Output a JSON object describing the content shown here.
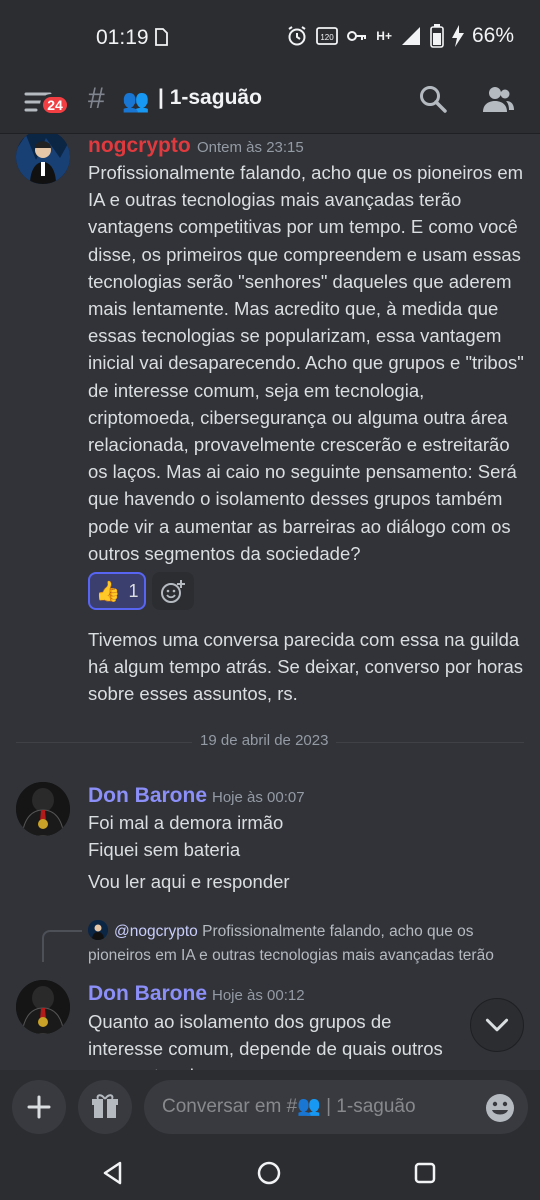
{
  "status_bar": {
    "time": "01:19",
    "battery": "66%",
    "network": "H+"
  },
  "channel_header": {
    "unread_badge": "24",
    "hash": "#",
    "channel_emoji": "👥",
    "channel_name": "| 1-saguão"
  },
  "messages": [
    {
      "author": "nogcrypto",
      "author_color": "#e03a3e",
      "timestamp": "Ontem às 23:15",
      "text": "Profissionalmente falando, acho que os pioneiros em IA e outras tecnologias mais avançadas terão vantagens competitivas por um tempo. E como você disse, os primeiros que compreendem e usam essas tecnologias serão \"senhores\" daqueles que aderem mais lentamente. Mas acredito que, à medida que essas tecnologias se popularizam, essa vantagem inicial vai desaparecendo. Acho que grupos e \"tribos\" de interesse comum, seja em tecnologia, criptomoeda, cibersegurança ou alguma outra área relacionada, provavelmente crescerão e estreitarão os laços. Mas ai caio no seguinte pensamento: Será que havendo o isolamento desses grupos também pode vir a aumentar as barreiras ao diálogo com os outros segmentos da sociedade?",
      "reaction": {
        "emoji": "👍",
        "count": "1"
      },
      "followup_text": "Tivemos uma conversa parecida com essa na guilda há algum tempo atrás. Se deixar, converso por horas sobre esses assuntos, rs."
    },
    {
      "date_divider": "19 de abril de 2023"
    },
    {
      "author": "Don Barone",
      "author_color": "#8b8ff7",
      "timestamp": "Hoje às 00:07",
      "lines": [
        "Foi mal a demora irmão",
        "Fiquei sem bateria",
        "Vou ler aqui e responder"
      ]
    },
    {
      "reply_to": {
        "mention": "@nogcrypto",
        "preview": "Profissionalmente falando, acho que os pioneiros em IA e outras tecnologias mais avançadas terão"
      },
      "author": "Don Barone",
      "author_color": "#8b8ff7",
      "timestamp": "Hoje às 00:12",
      "text": "Quanto ao isolamento dos grupos de interesse comum, depende de quais outros segmentos da"
    }
  ],
  "composer": {
    "placeholder": "Conversar em #👥 | 1-saguão"
  },
  "colors": {
    "background": "#313338",
    "header": "#2b2d31",
    "accent": "#5865f2",
    "badge": "#f23f43"
  },
  "icons": [
    "menu-icon",
    "people-icon",
    "search-icon",
    "members-icon",
    "add-reaction-icon",
    "chevron-down-icon",
    "plus-icon",
    "gift-icon",
    "emoji-icon",
    "back-icon",
    "home-icon",
    "recents-icon"
  ]
}
